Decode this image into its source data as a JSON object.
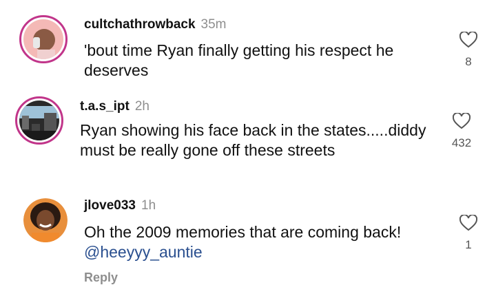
{
  "comments": [
    {
      "username": "cultchathrowback",
      "time": "35m",
      "text": "'bout time Ryan finally getting his respect he deserves",
      "likes": "8",
      "avatar_icon": "person-on-phone-avatar",
      "has_story_ring": true
    },
    {
      "username": "t.a.s_ipt",
      "time": "2h",
      "text": "Ryan showing his face back in the states.....diddy must be really gone off these streets",
      "likes": "432",
      "avatar_icon": "city-street-avatar",
      "has_story_ring": true
    },
    {
      "username": "jlove033",
      "time": "1h",
      "text": "Oh the 2009 memories that are coming back!",
      "mention": "@heeyyy_auntie",
      "likes": "1",
      "avatar_icon": "smiling-woman-avatar",
      "has_story_ring": false
    }
  ],
  "reply_label": "Reply",
  "colors": {
    "story_ring": "#c1358a",
    "mention": "#2a4f8f",
    "muted": "#8e8e8e"
  }
}
